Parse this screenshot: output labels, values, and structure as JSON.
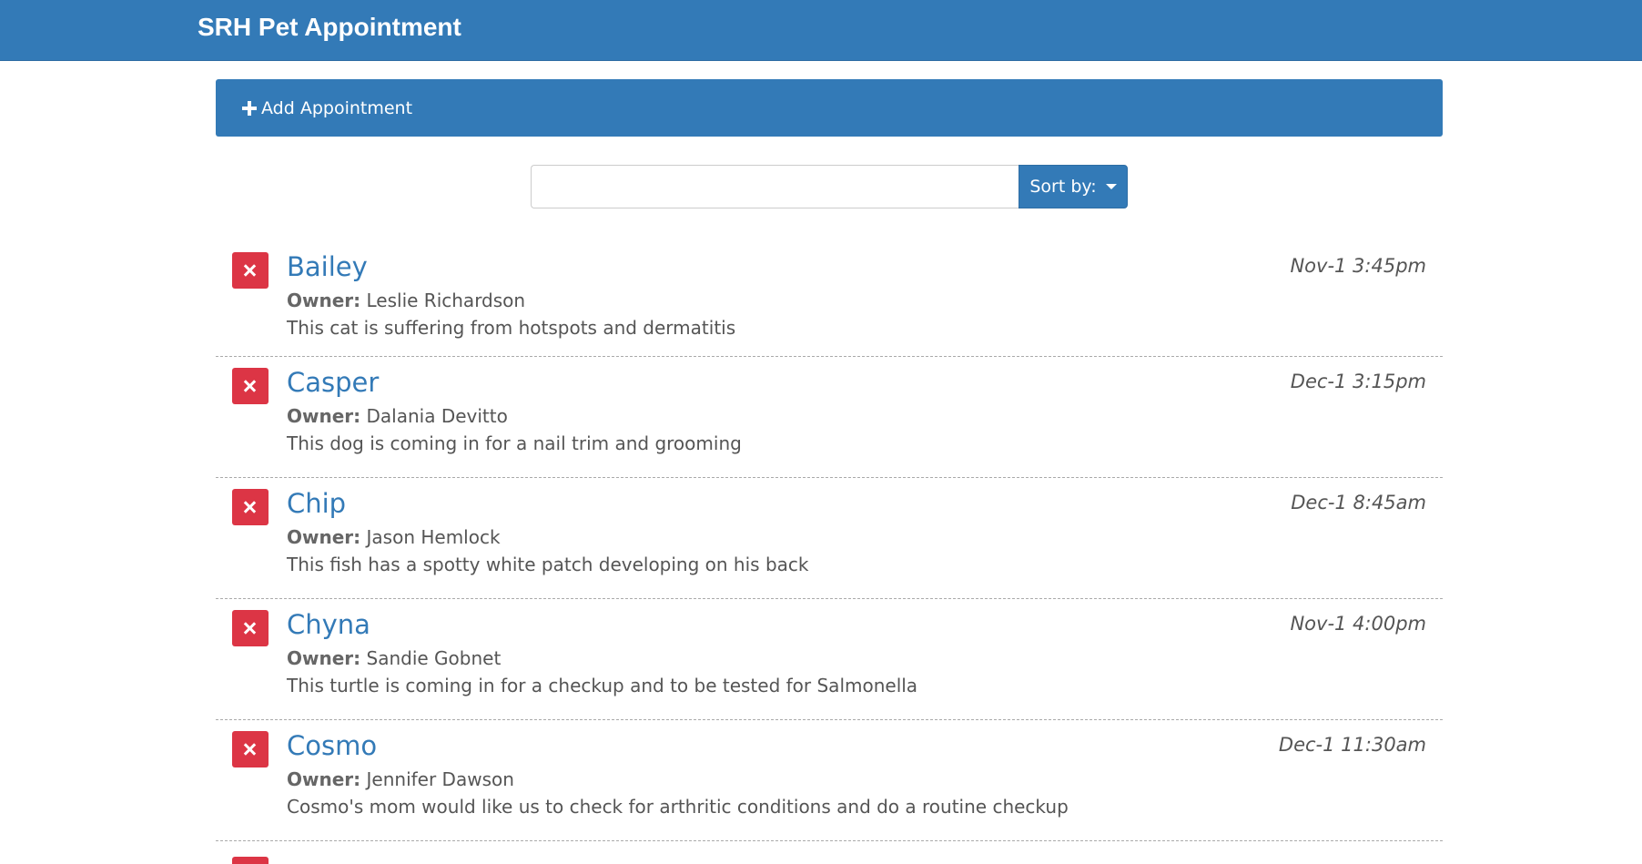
{
  "app": {
    "title": "SRH Pet Appointment"
  },
  "add_panel": {
    "label": "Add Appointment",
    "icon": "plus-icon"
  },
  "search": {
    "value": "",
    "placeholder": "",
    "sort_label": "Sort by:",
    "sort_icon": "caret-down-icon"
  },
  "appointments": [
    {
      "pet_name": "Bailey",
      "owner_label": "Owner:",
      "owner_name": "Leslie Richardson",
      "notes": "This cat is suffering from hotspots and dermatitis",
      "date": "Nov-1 3:45pm"
    },
    {
      "pet_name": "Casper",
      "owner_label": "Owner:",
      "owner_name": "Dalania Devitto",
      "notes": "This dog is coming in for a nail trim and grooming",
      "date": "Dec-1 3:15pm"
    },
    {
      "pet_name": "Chip",
      "owner_label": "Owner:",
      "owner_name": "Jason Hemlock",
      "notes": "This fish has a spotty white patch developing on his back",
      "date": "Dec-1 8:45am"
    },
    {
      "pet_name": "Chyna",
      "owner_label": "Owner:",
      "owner_name": "Sandie Gobnet",
      "notes": "This turtle is coming in for a checkup and to be tested for Salmonella",
      "date": "Nov-1 4:00pm"
    },
    {
      "pet_name": "Cosmo",
      "owner_label": "Owner:",
      "owner_name": "Jennifer Dawson",
      "notes": "Cosmo's mom would like us to check for arthritic conditions and do a routine checkup",
      "date": "Dec-1 11:30am"
    }
  ],
  "colors": {
    "primary": "#337ab7",
    "danger": "#dc3545",
    "text": "#555555"
  }
}
